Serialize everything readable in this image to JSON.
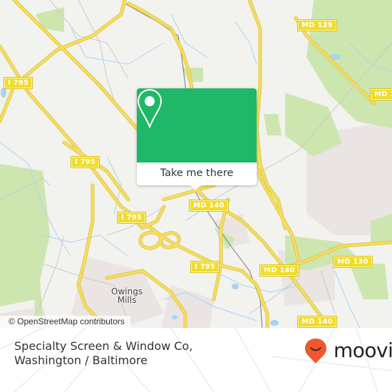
{
  "map": {
    "colors": {
      "background": "#f2f2ef",
      "park": "#cde6b0",
      "water": "#a8d4f2",
      "highway": "#f5de62",
      "highway_casing": "#e1c640",
      "minor_road": "#c8c8c8",
      "urban": "#eae4e2",
      "rail": "#777777",
      "shield_fill": "#f0dc2a"
    },
    "route_shields": [
      {
        "id": "md129",
        "label": "MD 129"
      },
      {
        "id": "md1xx-east",
        "label": "MD 1"
      },
      {
        "id": "i795-nw",
        "label": "I 795"
      },
      {
        "id": "i795-mid",
        "label": "I 795"
      },
      {
        "id": "i795-sw",
        "label": "I 795"
      },
      {
        "id": "i795-south",
        "label": "I 795"
      },
      {
        "id": "md140-center",
        "label": "MD 140"
      },
      {
        "id": "md140-east",
        "label": "MD 140"
      },
      {
        "id": "md130",
        "label": "MD 130"
      },
      {
        "id": "md140-se",
        "label": "MD 140"
      }
    ],
    "place_labels": [
      {
        "id": "owings-mills",
        "line1": "Owings",
        "line2": "Mills"
      }
    ],
    "attribution": "© OpenStreetMap contributors"
  },
  "popup": {
    "icon": "location-pin-icon",
    "button_label": "Take me there",
    "color": "#1fb868"
  },
  "footer": {
    "title": "Specialty Screen & Window Co, Washington / Baltimore",
    "brand": "moovit",
    "brand_color": "#f0572f"
  }
}
